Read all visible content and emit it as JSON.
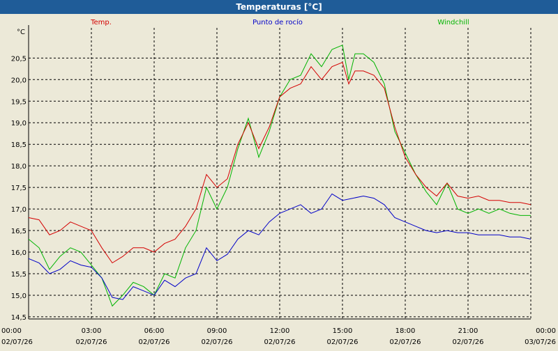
{
  "window": {
    "title": "Temperaturas [°C]"
  },
  "chart_data": {
    "type": "line",
    "title": "Temperaturas [°C]",
    "ylabel": "°C",
    "xlabel": "",
    "ylim": [
      14.45,
      21.2
    ],
    "y_ticks": [
      "14,5",
      "15,0",
      "15,5",
      "16,0",
      "16,5",
      "17,0",
      "17,5",
      "18,0",
      "18,5",
      "19,0",
      "19,5",
      "20,0",
      "20,5"
    ],
    "y_tick_values": [
      14.5,
      15.0,
      15.5,
      16.0,
      16.5,
      17.0,
      17.5,
      18.0,
      18.5,
      19.0,
      19.5,
      20.0,
      20.5
    ],
    "x_range_hours": [
      0,
      24
    ],
    "x_ticks": [
      {
        "time": "00:00",
        "date": "02/07/26",
        "hour": 0
      },
      {
        "time": "03:00",
        "date": "02/07/26",
        "hour": 3
      },
      {
        "time": "06:00",
        "date": "02/07/26",
        "hour": 6
      },
      {
        "time": "09:00",
        "date": "02/07/26",
        "hour": 9
      },
      {
        "time": "12:00",
        "date": "02/07/26",
        "hour": 12
      },
      {
        "time": "15:00",
        "date": "02/07/26",
        "hour": 15
      },
      {
        "time": "18:00",
        "date": "02/07/26",
        "hour": 18
      },
      {
        "time": "21:00",
        "date": "02/07/26",
        "hour": 21
      },
      {
        "time": "00:00",
        "date": "03/07/26",
        "hour": 24
      }
    ],
    "grid": true,
    "legend_placement": "top",
    "series": [
      {
        "name": "Temp.",
        "color": "#d40000",
        "points": [
          [
            0,
            16.8
          ],
          [
            0.5,
            16.75
          ],
          [
            1,
            16.4
          ],
          [
            1.5,
            16.5
          ],
          [
            2,
            16.7
          ],
          [
            2.5,
            16.6
          ],
          [
            3,
            16.5
          ],
          [
            3.5,
            16.1
          ],
          [
            4,
            15.75
          ],
          [
            4.5,
            15.9
          ],
          [
            5,
            16.1
          ],
          [
            5.5,
            16.1
          ],
          [
            6,
            16.0
          ],
          [
            6.5,
            16.2
          ],
          [
            7,
            16.3
          ],
          [
            7.5,
            16.6
          ],
          [
            8,
            17.0
          ],
          [
            8.5,
            17.8
          ],
          [
            9,
            17.5
          ],
          [
            9.5,
            17.7
          ],
          [
            10,
            18.5
          ],
          [
            10.5,
            19.0
          ],
          [
            11,
            18.4
          ],
          [
            11.5,
            18.9
          ],
          [
            12,
            19.6
          ],
          [
            12.5,
            19.8
          ],
          [
            13,
            19.9
          ],
          [
            13.5,
            20.3
          ],
          [
            14,
            20.0
          ],
          [
            14.5,
            20.3
          ],
          [
            15,
            20.4
          ],
          [
            15.3,
            19.9
          ],
          [
            15.6,
            20.2
          ],
          [
            16,
            20.2
          ],
          [
            16.5,
            20.1
          ],
          [
            17,
            19.8
          ],
          [
            17.5,
            18.9
          ],
          [
            18,
            18.2
          ],
          [
            18.5,
            17.8
          ],
          [
            19,
            17.5
          ],
          [
            19.5,
            17.3
          ],
          [
            20,
            17.6
          ],
          [
            20.5,
            17.3
          ],
          [
            21,
            17.25
          ],
          [
            21.5,
            17.3
          ],
          [
            22,
            17.2
          ],
          [
            22.5,
            17.2
          ],
          [
            23,
            17.15
          ],
          [
            23.5,
            17.15
          ],
          [
            24,
            17.1
          ]
        ]
      },
      {
        "name": "Punto de rocío",
        "color": "#0000c8",
        "points": [
          [
            0,
            15.85
          ],
          [
            0.5,
            15.75
          ],
          [
            1,
            15.5
          ],
          [
            1.5,
            15.6
          ],
          [
            2,
            15.8
          ],
          [
            2.5,
            15.7
          ],
          [
            3,
            15.65
          ],
          [
            3.5,
            15.4
          ],
          [
            4,
            14.95
          ],
          [
            4.5,
            14.9
          ],
          [
            5,
            15.2
          ],
          [
            5.5,
            15.1
          ],
          [
            6,
            15.0
          ],
          [
            6.5,
            15.35
          ],
          [
            7,
            15.2
          ],
          [
            7.5,
            15.4
          ],
          [
            8,
            15.5
          ],
          [
            8.5,
            16.1
          ],
          [
            9,
            15.8
          ],
          [
            9.5,
            15.95
          ],
          [
            10,
            16.3
          ],
          [
            10.5,
            16.5
          ],
          [
            11,
            16.4
          ],
          [
            11.5,
            16.7
          ],
          [
            12,
            16.9
          ],
          [
            12.5,
            17.0
          ],
          [
            13,
            17.1
          ],
          [
            13.5,
            16.9
          ],
          [
            14,
            17.0
          ],
          [
            14.5,
            17.35
          ],
          [
            15,
            17.2
          ],
          [
            15.5,
            17.25
          ],
          [
            16,
            17.3
          ],
          [
            16.5,
            17.25
          ],
          [
            17,
            17.1
          ],
          [
            17.5,
            16.8
          ],
          [
            18,
            16.7
          ],
          [
            18.5,
            16.6
          ],
          [
            19,
            16.5
          ],
          [
            19.5,
            16.45
          ],
          [
            20,
            16.5
          ],
          [
            20.5,
            16.45
          ],
          [
            21,
            16.45
          ],
          [
            21.5,
            16.4
          ],
          [
            22,
            16.4
          ],
          [
            22.5,
            16.4
          ],
          [
            23,
            16.35
          ],
          [
            23.5,
            16.35
          ],
          [
            24,
            16.3
          ]
        ]
      },
      {
        "name": "Windchill",
        "color": "#00b400",
        "points": [
          [
            0,
            16.3
          ],
          [
            0.5,
            16.1
          ],
          [
            1,
            15.6
          ],
          [
            1.5,
            15.9
          ],
          [
            2,
            16.1
          ],
          [
            2.5,
            16.0
          ],
          [
            3,
            15.7
          ],
          [
            3.5,
            15.4
          ],
          [
            4,
            14.75
          ],
          [
            4.5,
            15.0
          ],
          [
            5,
            15.3
          ],
          [
            5.5,
            15.2
          ],
          [
            6,
            15.0
          ],
          [
            6.5,
            15.5
          ],
          [
            7,
            15.4
          ],
          [
            7.5,
            16.1
          ],
          [
            8,
            16.5
          ],
          [
            8.5,
            17.5
          ],
          [
            9,
            17.0
          ],
          [
            9.5,
            17.5
          ],
          [
            10,
            18.4
          ],
          [
            10.5,
            19.1
          ],
          [
            11,
            18.2
          ],
          [
            11.5,
            18.8
          ],
          [
            12,
            19.6
          ],
          [
            12.5,
            20.0
          ],
          [
            13,
            20.1
          ],
          [
            13.5,
            20.6
          ],
          [
            14,
            20.3
          ],
          [
            14.5,
            20.7
          ],
          [
            15,
            20.8
          ],
          [
            15.3,
            20.0
          ],
          [
            15.6,
            20.6
          ],
          [
            16,
            20.6
          ],
          [
            16.5,
            20.4
          ],
          [
            17,
            19.9
          ],
          [
            17.5,
            18.8
          ],
          [
            18,
            18.3
          ],
          [
            18.5,
            17.8
          ],
          [
            19,
            17.4
          ],
          [
            19.5,
            17.1
          ],
          [
            20,
            17.6
          ],
          [
            20.5,
            17.0
          ],
          [
            21,
            16.9
          ],
          [
            21.5,
            17.0
          ],
          [
            22,
            16.9
          ],
          [
            22.5,
            17.0
          ],
          [
            23,
            16.9
          ],
          [
            23.5,
            16.85
          ],
          [
            24,
            16.85
          ]
        ]
      }
    ]
  }
}
